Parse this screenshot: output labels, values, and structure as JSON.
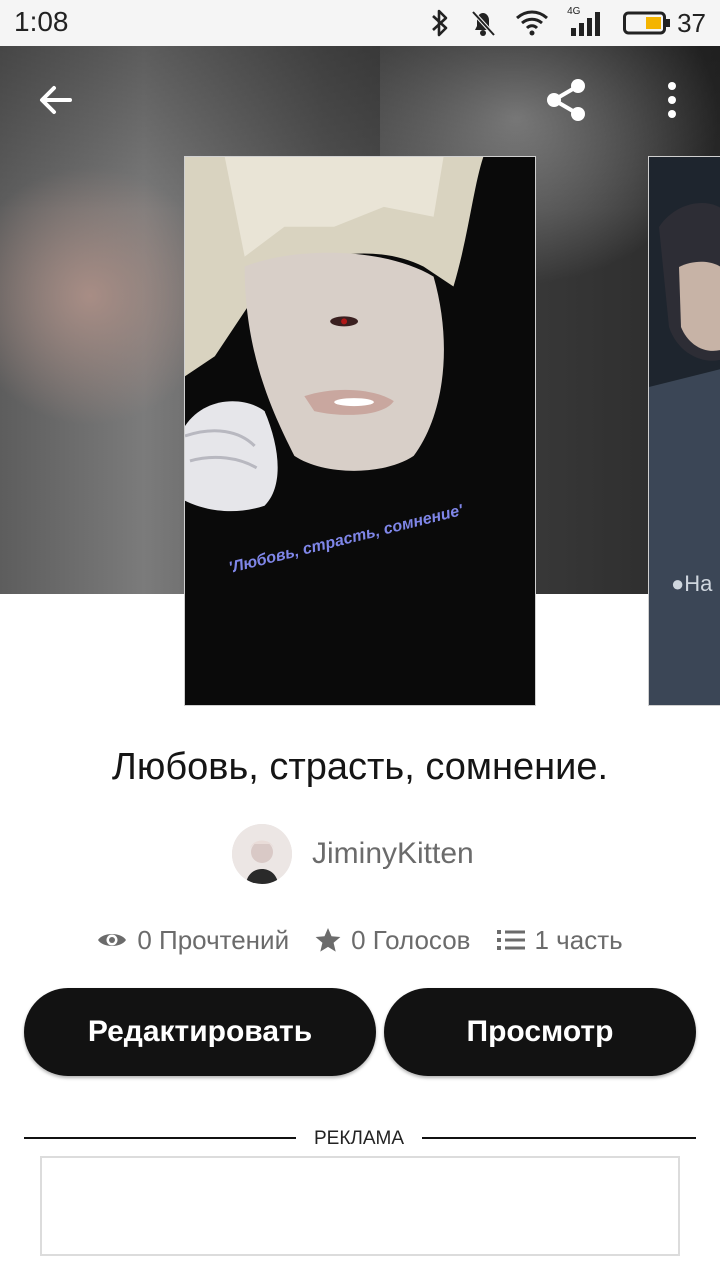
{
  "status_bar": {
    "time": "1:08",
    "battery": "37",
    "network": "4G"
  },
  "cover_caption": "'Любовь, страсть, сомнение'",
  "next_cover_caption": "●Ha",
  "story": {
    "title": "Любовь, страсть, сомнение.",
    "author": "JiminyKitten"
  },
  "stats": {
    "reads": "0 Прочтений",
    "votes": "0 Голосов",
    "parts": "1 часть"
  },
  "buttons": {
    "edit": "Редактировать",
    "view": "Просмотр"
  },
  "ad": {
    "label": "РЕКЛАМА"
  },
  "icons": {
    "back": "arrow-left-icon",
    "share": "share-icon",
    "more": "more-vertical-icon",
    "reads": "eye-icon",
    "votes": "star-icon",
    "parts": "list-icon"
  },
  "colors": {
    "button_bg": "#121212",
    "meta_text": "#6b6b6b"
  }
}
